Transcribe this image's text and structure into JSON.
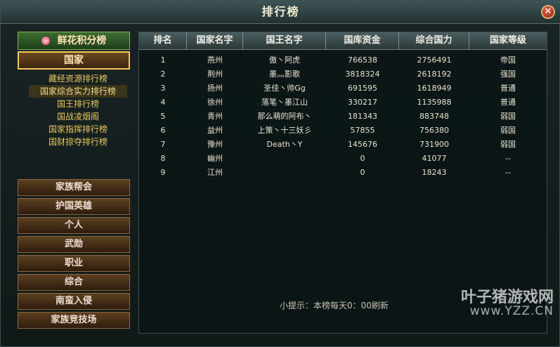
{
  "window": {
    "title": "排行榜",
    "close_icon": "✕"
  },
  "sidebar": {
    "flower_btn": "鲜花积分榜",
    "nation_btn": "国家",
    "sub_items": [
      "藏经资源排行榜",
      "国家综合实力排行榜",
      "国王排行榜",
      "国战凌烟阁",
      "国家指挥排行榜",
      "国财掠夺排行榜"
    ],
    "active_sub_index": 1,
    "categories": [
      "家族帮会",
      "护国英雄",
      "个人",
      "武勋",
      "职业",
      "综合",
      "南蛮入侵",
      "家族竞技场"
    ]
  },
  "table": {
    "columns": [
      "排名",
      "国家名字",
      "国王名字",
      "国库资金",
      "综合国力",
      "国家等级"
    ],
    "rows": [
      [
        "1",
        "燕州",
        "傲丶阿虎",
        "766538",
        "2756491",
        "帝国"
      ],
      [
        "2",
        "荆州",
        "墨灬影歌",
        "3818324",
        "2618192",
        "强国"
      ],
      [
        "3",
        "扬州",
        "圣佳丶帅Gg",
        "691595",
        "1618949",
        "普通"
      ],
      [
        "4",
        "徐州",
        "落笔丶墨江山",
        "330217",
        "1135988",
        "普通"
      ],
      [
        "5",
        "青州",
        "那么萌的阿布丶",
        "181343",
        "883748",
        "弱国"
      ],
      [
        "6",
        "益州",
        "上策丶十三妖彡",
        "57855",
        "756380",
        "弱国"
      ],
      [
        "7",
        "豫州",
        "Death丶Y",
        "145676",
        "731900",
        "弱国"
      ],
      [
        "8",
        "幽州",
        "",
        "0",
        "41077",
        "--"
      ],
      [
        "9",
        "江州",
        "",
        "0",
        "18243",
        "--"
      ]
    ]
  },
  "tip": "小提示：本榜每天0：00刷新",
  "watermark": {
    "cn": "叶子猪游戏网",
    "en": "www.YZZ.CN"
  },
  "colors": {
    "accent_gold": "#f2c95a",
    "header_bg": "#2b3837"
  }
}
